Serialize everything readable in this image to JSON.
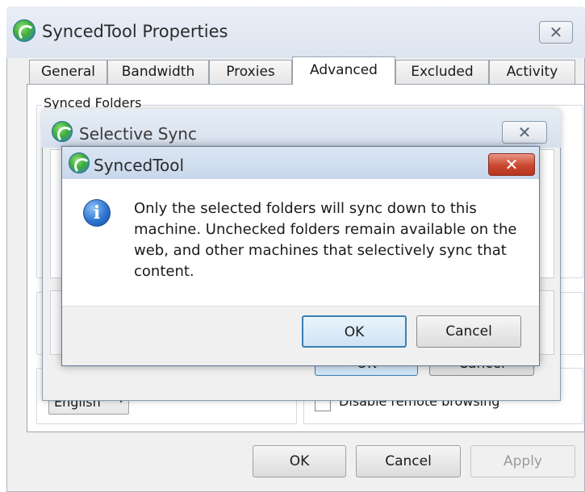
{
  "main_window": {
    "title": "SyncedTool Properties",
    "tabs": [
      "General",
      "Bandwidth",
      "Proxies",
      "Advanced",
      "Excluded",
      "Activity"
    ],
    "active_tab": "Advanced",
    "synced_folders_label": "Synced Folders",
    "language_value": "English",
    "disable_remote_browsing_label": "Disable remote browsing",
    "buttons": {
      "ok": "OK",
      "cancel": "Cancel",
      "apply": "Apply"
    }
  },
  "selective_sync": {
    "title": "Selective Sync",
    "ok_label": "OK",
    "cancel_label": "Cancel"
  },
  "message_box": {
    "title": "SyncedTool",
    "message": "Only the selected folders will sync down to this machine. Unchecked folders remain available on the web, and other machines that selectively sync that content.",
    "ok_label": "OK",
    "cancel_label": "Cancel"
  }
}
